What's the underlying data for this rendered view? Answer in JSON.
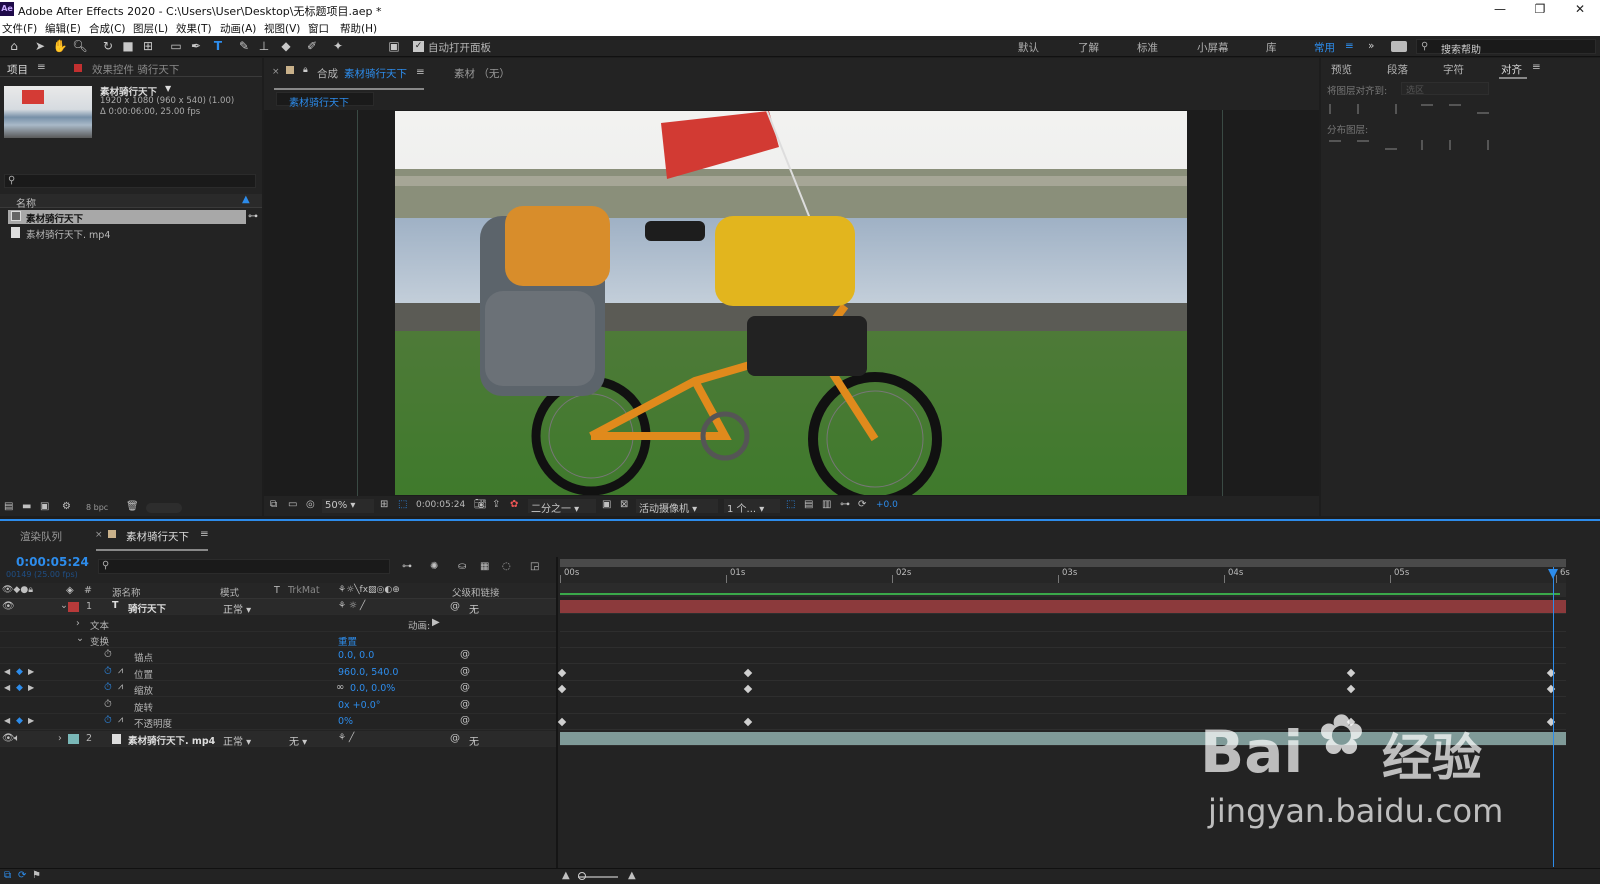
{
  "window": {
    "app_icon": "Ae",
    "title": "Adobe After Effects 2020 - C:\\Users\\User\\Desktop\\无标题项目.aep *"
  },
  "menu": [
    "文件(F)",
    "编辑(E)",
    "合成(C)",
    "图层(L)",
    "效果(T)",
    "动画(A)",
    "视图(V)",
    "窗口",
    "帮助(H)"
  ],
  "toolbar": {
    "auto_open_label": "自动打开面板",
    "workspaces": [
      "默认",
      "了解",
      "标准",
      "小屏幕",
      "库",
      "常用"
    ],
    "active_workspace": "常用",
    "search_placeholder": "搜索帮助",
    "more": "»"
  },
  "project": {
    "tab": "项目",
    "effects_tab": "效果控件 骑行天下",
    "item_name": "素材骑行天下",
    "item_dims": "1920 x 1080  (960 x 540) (1.00)",
    "item_duration": "Δ 0:00:06:00, 25.00 fps",
    "name_col": "名称",
    "items": [
      "素材骑行天下",
      "素材骑行天下. mp4"
    ],
    "bpc": "8 bpc"
  },
  "composition": {
    "tab_prefix": "合成",
    "tab_name": "素材骑行天下",
    "footage_tab": "素材 （无）",
    "subtab": "素材骑行天下",
    "zoom": "50%",
    "timecode": "0:00:05:24",
    "resolution": "二分之一",
    "camera": "活动摄像机",
    "views": "1 个...",
    "offset": "+0.0"
  },
  "right_panel": {
    "tabs": [
      "预览",
      "段落",
      "字符",
      "对齐"
    ],
    "active_tab": "对齐",
    "align_to_label": "将图层对齐到:",
    "align_to_value": "选区",
    "distribute_label": "分布图层:"
  },
  "timeline": {
    "render_queue_tab": "渲染队列",
    "comp_tab": "素材骑行天下",
    "timecode": "0:00:05:24",
    "frame_info": "00149 (25.00 fps)",
    "headers": {
      "num": "#",
      "source": "源名称",
      "mode": "模式",
      "t": "T",
      "trkmat": "TrkMat",
      "parent": "父级和链接"
    },
    "ruler": [
      "00s",
      "01s",
      "02s",
      "03s",
      "04s",
      "05s",
      "6s"
    ],
    "layer1": {
      "num": "1",
      "type": "T",
      "name": "骑行天下",
      "mode": "正常",
      "parent": "无",
      "color": "#b83a3a"
    },
    "text_group": "文本",
    "animate_label": "动画:",
    "transform_group": "变换",
    "reset_label": "重置",
    "props": [
      {
        "name": "锚点",
        "value": "0.0, 0.0"
      },
      {
        "name": "位置",
        "value": "960.0, 540.0"
      },
      {
        "name": "缩放",
        "value": "0.0, 0.0%"
      },
      {
        "name": "旋转",
        "value": "0x +0.0°"
      },
      {
        "name": "不透明度",
        "value": "0%"
      }
    ],
    "layer2": {
      "num": "2",
      "name": "素材骑行天下. mp4",
      "mode": "正常",
      "trkmat": "无",
      "parent": "无",
      "color": "#7ab8b8"
    },
    "keyframe_times": {
      "position": [
        0,
        1.12,
        4.75,
        5.96
      ],
      "scale": [
        0,
        1.12,
        4.75,
        5.96
      ],
      "opacity": [
        0,
        1.12,
        4.75,
        5.96
      ]
    }
  },
  "watermark": {
    "brand": "Bai",
    "brand2": "经验",
    "url": "jingyan.baidu.com"
  }
}
